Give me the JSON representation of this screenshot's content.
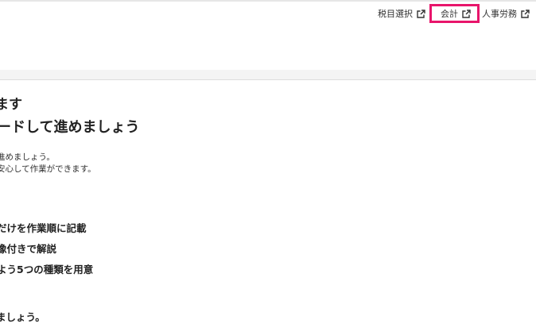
{
  "nav": {
    "links": [
      {
        "label": "税目選択",
        "icon": "external-link-icon"
      },
      {
        "label": "会計",
        "icon": "external-link-icon",
        "highlighted": true
      },
      {
        "label": "人事労務",
        "icon": "external-link-icon"
      }
    ]
  },
  "colors": {
    "highlight_border": "#e8156b",
    "header_band": "#f4f4f4",
    "text": "#222222"
  },
  "hero": {
    "line1": "ます",
    "line2": "ードして進めましょう"
  },
  "description": {
    "line1": "進めましょう。",
    "line2": "安心して作業ができます。"
  },
  "features": [
    "だけを作業順に記載",
    "像付きで解説",
    "よう5つの種類を用意"
  ],
  "closing": "ましょう。"
}
